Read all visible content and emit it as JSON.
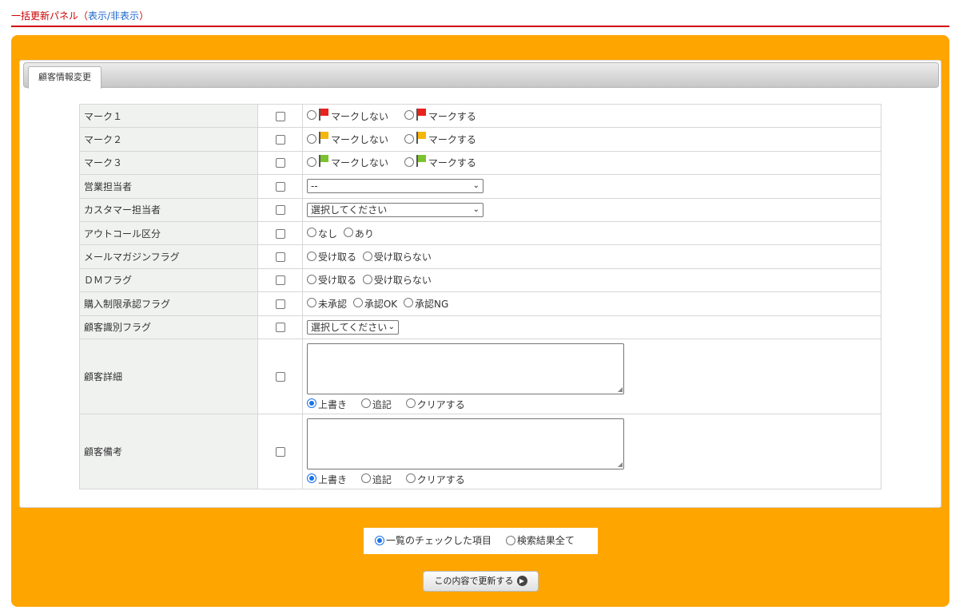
{
  "header": {
    "title": "一括更新パネル（",
    "toggle_label": "表示/非表示",
    "close_paren": "）"
  },
  "tab": {
    "label": "顧客情報変更"
  },
  "rows": {
    "mark1": {
      "label": "マーク１",
      "opt_off": "マークしない",
      "opt_on": "マークする",
      "color": "#e8221c"
    },
    "mark2": {
      "label": "マーク２",
      "opt_off": "マークしない",
      "opt_on": "マークする",
      "color": "#f5b50a"
    },
    "mark3": {
      "label": "マーク３",
      "opt_off": "マークしない",
      "opt_on": "マークする",
      "color": "#7cc22e"
    },
    "sales_rep": {
      "label": "営業担当者",
      "select_value": "--"
    },
    "cs_rep": {
      "label": "カスタマー担当者",
      "select_value": "選択してください"
    },
    "outcall": {
      "label": "アウトコール区分",
      "opt_none": "なし",
      "opt_yes": "あり"
    },
    "mailmag": {
      "label": "メールマガジンフラグ",
      "opt_receive": "受け取る",
      "opt_reject": "受け取らない"
    },
    "dm": {
      "label": "ＤＭフラグ",
      "opt_receive": "受け取る",
      "opt_reject": "受け取らない"
    },
    "purchase": {
      "label": "購入制限承認フラグ",
      "opt_pending": "未承認",
      "opt_ok": "承認OK",
      "opt_ng": "承認NG"
    },
    "identity": {
      "label": "顧客識別フラグ",
      "select_value": "選択してください"
    },
    "detail": {
      "label": "顧客詳細",
      "opt_overwrite": "上書き",
      "opt_append": "追記",
      "opt_clear": "クリアする"
    },
    "memo": {
      "label": "顧客備考",
      "opt_overwrite": "上書き",
      "opt_append": "追記",
      "opt_clear": "クリアする"
    }
  },
  "scope": {
    "opt_checked": "一覧のチェックした項目",
    "opt_all": "検索結果全て",
    "selected": "opt_checked"
  },
  "submit": {
    "label": "この内容で更新する"
  }
}
